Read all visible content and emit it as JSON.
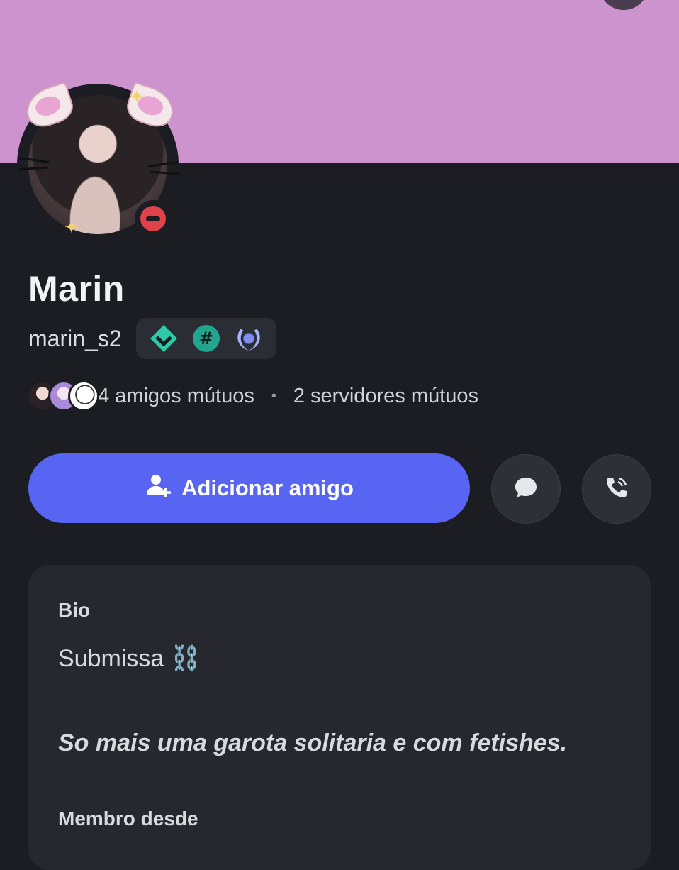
{
  "profile": {
    "display_name": "Marin",
    "username": "marin_s2",
    "status": "do-not-disturb",
    "banner_color": "#cc93cf",
    "badges": [
      "hypesquad-balance-icon",
      "active-developer-icon",
      "quest-laurel-icon"
    ]
  },
  "mutuals": {
    "friends_text": "4 amigos mútuos",
    "separator": "•",
    "servers_text": "2 servidores mútuos"
  },
  "actions": {
    "add_friend_label": "Adicionar amigo",
    "message_icon": "chat-bubble-icon",
    "call_icon": "phone-call-icon",
    "accent_color": "#5865f2"
  },
  "card": {
    "bio_label": "Bio",
    "bio_line1": "Submissa ⛓️",
    "bio_line2": "So mais uma garota solitaria e com fetishes.",
    "member_since_label": "Membro desde"
  }
}
